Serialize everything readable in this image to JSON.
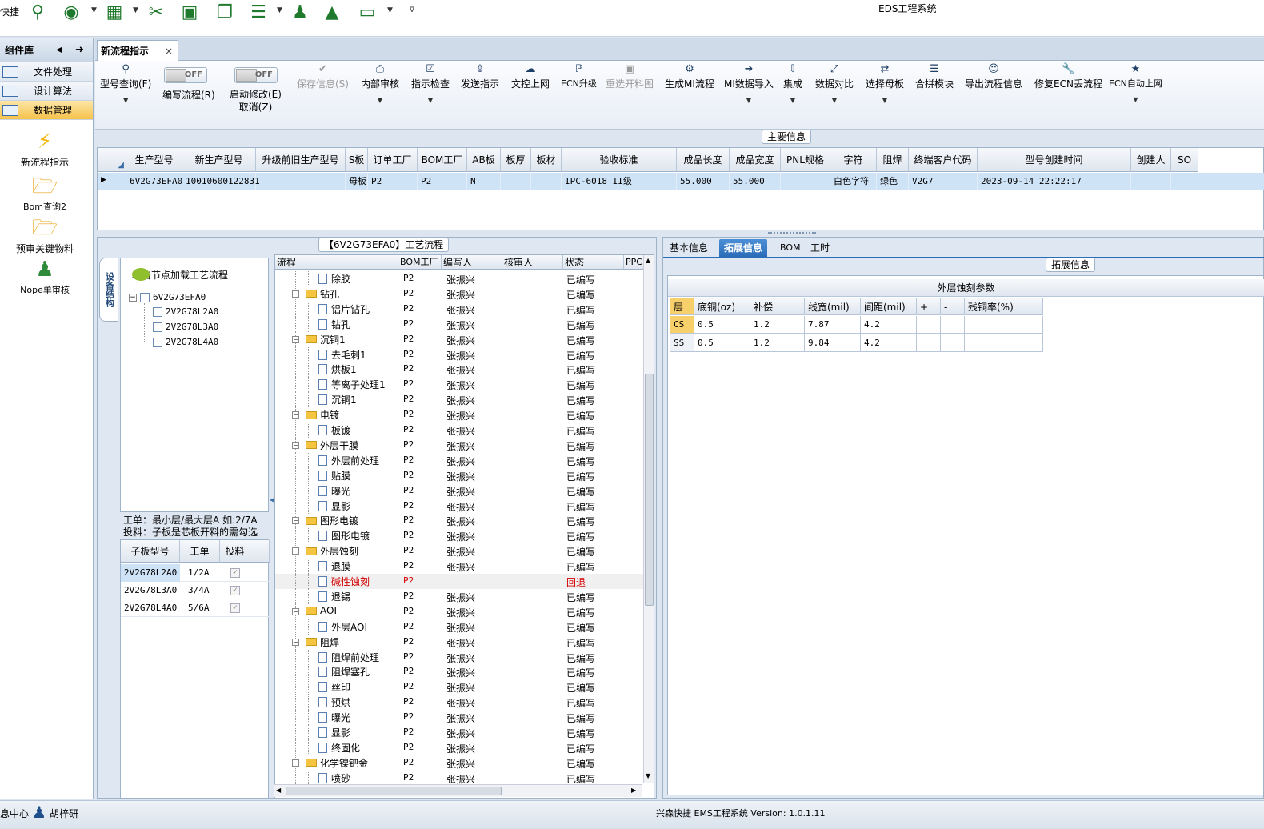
{
  "app": {
    "title": "EDS工程系统",
    "quick_label": "快捷"
  },
  "left_panel": {
    "title": "组件库",
    "nav": [
      {
        "label": "文件处理"
      },
      {
        "label": "设计算法"
      },
      {
        "label": "数据管理"
      }
    ],
    "big_items": [
      {
        "label": "新流程指示"
      },
      {
        "label": "Bom查询2"
      },
      {
        "label": "预审关键物料"
      },
      {
        "label": "Nope单审核"
      }
    ]
  },
  "doc_tab": {
    "label": "新流程指示",
    "close": "×"
  },
  "toolbar": {
    "toggle_off": "OFF",
    "items": [
      {
        "label": "型号查询(F)"
      },
      {
        "label": "编写流程(R)"
      },
      {
        "label": "启动修改(E)",
        "label2": "取消(Z)"
      },
      {
        "label": "保存信息(S)"
      },
      {
        "label": "内部审核"
      },
      {
        "label": "指示检查"
      },
      {
        "label": "发送指示"
      },
      {
        "label": "文控上网"
      },
      {
        "label": "ECN升级"
      },
      {
        "label": "重选开料图"
      },
      {
        "label": "生成MI流程"
      },
      {
        "label": "MI数据导入"
      },
      {
        "label": "集成"
      },
      {
        "label": "数据对比"
      },
      {
        "label": "选择母板"
      },
      {
        "label": "合拼模块"
      },
      {
        "label": "导出流程信息"
      },
      {
        "label": "修复ECN丢流程"
      },
      {
        "label": "ECN自动上网"
      }
    ]
  },
  "main_info": {
    "group_title": "主要信息",
    "columns": [
      "生产型号",
      "新生产型号",
      "升级前旧生产型号",
      "S板",
      "订单工厂",
      "BOM工厂",
      "AB板",
      "板厚",
      "板材",
      "验收标准",
      "成品长度",
      "成品宽度",
      "PNL规格",
      "字符",
      "阻焊",
      "终端客户代码",
      "型号创建时间",
      "创建人",
      "SO"
    ],
    "row": [
      "6V2G73EFA0",
      "10010600122831",
      "",
      "母板",
      "P2",
      "P2",
      "N",
      "",
      "",
      "IPC-6018 II级",
      "55.000",
      "55.000",
      "",
      "白色字符",
      "绿色",
      "V2G7",
      "2023-09-14 22:22:17",
      "",
      ""
    ]
  },
  "process_panel": {
    "group_title": "【6V2G73EFA0】工艺流程",
    "side_tab": "设备结构",
    "tree_hint": "单击节点加载工艺流程",
    "tree_root": "6V2G73EFA0",
    "tree_children": [
      "2V2G78L2A0",
      "2V2G78L3A0",
      "2V2G78L4A0"
    ],
    "info_line1": "工单：最小层/最大层A 如:2/7A",
    "info_line2": "投料：子板是芯板开料的需勾选",
    "sub_columns": [
      "子板型号",
      "工单",
      "投料"
    ],
    "sub_rows": [
      {
        "model": "2V2G78L2A0",
        "order": "1/2A",
        "check": "✓"
      },
      {
        "model": "2V2G78L3A0",
        "order": "3/4A",
        "check": "✓"
      },
      {
        "model": "2V2G78L4A0",
        "order": "5/6A",
        "check": "✓"
      }
    ],
    "columns": [
      "流程",
      "BOM工厂",
      "编写人",
      "核审人",
      "状态",
      "PPC"
    ],
    "rows": [
      {
        "name": "除胶",
        "level": 2,
        "factory": "P2",
        "author": "张振兴",
        "status": "已编写"
      },
      {
        "name": "钻孔",
        "level": 1,
        "factory": "P2",
        "author": "张振兴",
        "status": "已编写"
      },
      {
        "name": "铝片钻孔",
        "level": 2,
        "factory": "P2",
        "author": "张振兴",
        "status": "已编写"
      },
      {
        "name": "钻孔",
        "level": 2,
        "factory": "P2",
        "author": "张振兴",
        "status": "已编写"
      },
      {
        "name": "沉铜1",
        "level": 1,
        "factory": "P2",
        "author": "张振兴",
        "status": "已编写"
      },
      {
        "name": "去毛刺1",
        "level": 2,
        "factory": "P2",
        "author": "张振兴",
        "status": "已编写"
      },
      {
        "name": "烘板1",
        "level": 2,
        "factory": "P2",
        "author": "张振兴",
        "status": "已编写"
      },
      {
        "name": "等离子处理1",
        "level": 2,
        "factory": "P2",
        "author": "张振兴",
        "status": "已编写"
      },
      {
        "name": "沉铜1",
        "level": 2,
        "factory": "P2",
        "author": "张振兴",
        "status": "已编写"
      },
      {
        "name": "电镀",
        "level": 1,
        "factory": "P2",
        "author": "张振兴",
        "status": "已编写"
      },
      {
        "name": "板镀",
        "level": 2,
        "factory": "P2",
        "author": "张振兴",
        "status": "已编写"
      },
      {
        "name": "外层干膜",
        "level": 1,
        "factory": "P2",
        "author": "张振兴",
        "status": "已编写"
      },
      {
        "name": "外层前处理",
        "level": 2,
        "factory": "P2",
        "author": "张振兴",
        "status": "已编写"
      },
      {
        "name": "贴膜",
        "level": 2,
        "factory": "P2",
        "author": "张振兴",
        "status": "已编写"
      },
      {
        "name": "曝光",
        "level": 2,
        "factory": "P2",
        "author": "张振兴",
        "status": "已编写"
      },
      {
        "name": "显影",
        "level": 2,
        "factory": "P2",
        "author": "张振兴",
        "status": "已编写"
      },
      {
        "name": "图形电镀",
        "level": 1,
        "factory": "P2",
        "author": "张振兴",
        "status": "已编写"
      },
      {
        "name": "图形电镀",
        "level": 2,
        "factory": "P2",
        "author": "张振兴",
        "status": "已编写"
      },
      {
        "name": "外层蚀刻",
        "level": 1,
        "factory": "P2",
        "author": "张振兴",
        "status": "已编写"
      },
      {
        "name": "退膜",
        "level": 2,
        "factory": "P2",
        "author": "张振兴",
        "status": "已编写"
      },
      {
        "name": "碱性蚀刻",
        "level": 2,
        "factory": "P2",
        "author": "",
        "status": "回退",
        "highlight": true
      },
      {
        "name": "退锡",
        "level": 2,
        "factory": "P2",
        "author": "张振兴",
        "status": "已编写"
      },
      {
        "name": "AOI",
        "level": 1,
        "factory": "P2",
        "author": "张振兴",
        "status": "已编写"
      },
      {
        "name": "外层AOI",
        "level": 2,
        "factory": "P2",
        "author": "张振兴",
        "status": "已编写"
      },
      {
        "name": "阻焊",
        "level": 1,
        "factory": "P2",
        "author": "张振兴",
        "status": "已编写"
      },
      {
        "name": "阻焊前处理",
        "level": 2,
        "factory": "P2",
        "author": "张振兴",
        "status": "已编写"
      },
      {
        "name": "阻焊塞孔",
        "level": 2,
        "factory": "P2",
        "author": "张振兴",
        "status": "已编写"
      },
      {
        "name": "丝印",
        "level": 2,
        "factory": "P2",
        "author": "张振兴",
        "status": "已编写"
      },
      {
        "name": "预烘",
        "level": 2,
        "factory": "P2",
        "author": "张振兴",
        "status": "已编写"
      },
      {
        "name": "曝光",
        "level": 2,
        "factory": "P2",
        "author": "张振兴",
        "status": "已编写"
      },
      {
        "name": "显影",
        "level": 2,
        "factory": "P2",
        "author": "张振兴",
        "status": "已编写"
      },
      {
        "name": "终固化",
        "level": 2,
        "factory": "P2",
        "author": "张振兴",
        "status": "已编写"
      },
      {
        "name": "化学镍钯金",
        "level": 1,
        "factory": "P2",
        "author": "张振兴",
        "status": "已编写"
      },
      {
        "name": "喷砂",
        "level": 2,
        "factory": "P2",
        "author": "张振兴",
        "status": "已编写"
      }
    ]
  },
  "right_panel": {
    "tabs": [
      "基本信息",
      "拓展信息",
      "BOM",
      "工时"
    ],
    "group_title": "拓展信息",
    "table_title": "外层蚀刻参数",
    "columns": [
      "层",
      "底铜(oz)",
      "补偿",
      "线宽(mil)",
      "间距(mil)",
      "+",
      "-",
      "残铜率(%)"
    ],
    "rows": [
      [
        "CS",
        "0.5",
        "1.2",
        "7.87",
        "4.2",
        "",
        "",
        ""
      ],
      [
        "SS",
        "0.5",
        "1.2",
        "9.84",
        "4.2",
        "",
        "",
        ""
      ]
    ]
  },
  "status_bar": {
    "left": "息中心",
    "user": "胡梓研",
    "right": "兴森快捷 EMS工程系统 Version: 1.0.1.11"
  },
  "colors": {
    "selection_row": "#cfe3f7",
    "highlight_nav": "#f6c24a",
    "accent_tab": "#2a6cb8",
    "rollback_text": "#d40000"
  }
}
